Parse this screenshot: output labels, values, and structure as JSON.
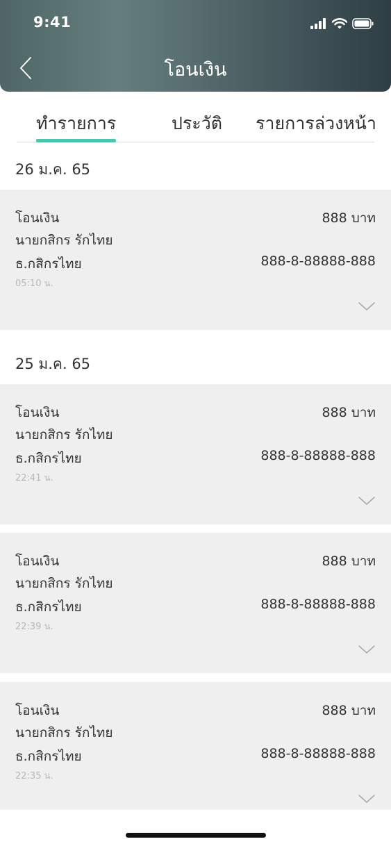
{
  "status_bar": {
    "time": "9:41",
    "icons": [
      "cellular-signal-icon",
      "wifi-icon",
      "battery-icon"
    ]
  },
  "header": {
    "title": "โอนเงิน",
    "back_icon": "chevron-left-icon"
  },
  "tabs": [
    {
      "label": "ทำรายการ",
      "active": true
    },
    {
      "label": "ประวัติ",
      "active": false
    },
    {
      "label": "รายการล่วงหน้า",
      "active": false
    }
  ],
  "groups": [
    {
      "date": "26 ม.ค. 65",
      "transactions": [
        {
          "type": "โอนเงิน",
          "name": "นายกสิกร รักไทย",
          "bank": "ธ.กสิกรไทย",
          "time": "05:10 น.",
          "amount": "888 บาท",
          "account": "888-8-88888-888"
        }
      ]
    },
    {
      "date": "25 ม.ค. 65",
      "transactions": [
        {
          "type": "โอนเงิน",
          "name": "นายกสิกร รักไทย",
          "bank": "ธ.กสิกรไทย",
          "time": "22:41 น.",
          "amount": "888 บาท",
          "account": "888-8-88888-888"
        },
        {
          "type": "โอนเงิน",
          "name": "นายกสิกร รักไทย",
          "bank": "ธ.กสิกรไทย",
          "time": "22:39 น.",
          "amount": "888 บาท",
          "account": "888-8-88888-888"
        },
        {
          "type": "โอนเงิน",
          "name": "นายกสิกร รักไทย",
          "bank": "ธ.กสิกรไทย",
          "time": "22:35 น.",
          "amount": "888 บาท",
          "account": "888-8-88888-888"
        }
      ]
    }
  ],
  "colors": {
    "accent": "#4cc5ad",
    "card_background": "#efefef",
    "header_gradient_start": "#4f6566",
    "header_gradient_end": "#2e3e44"
  }
}
